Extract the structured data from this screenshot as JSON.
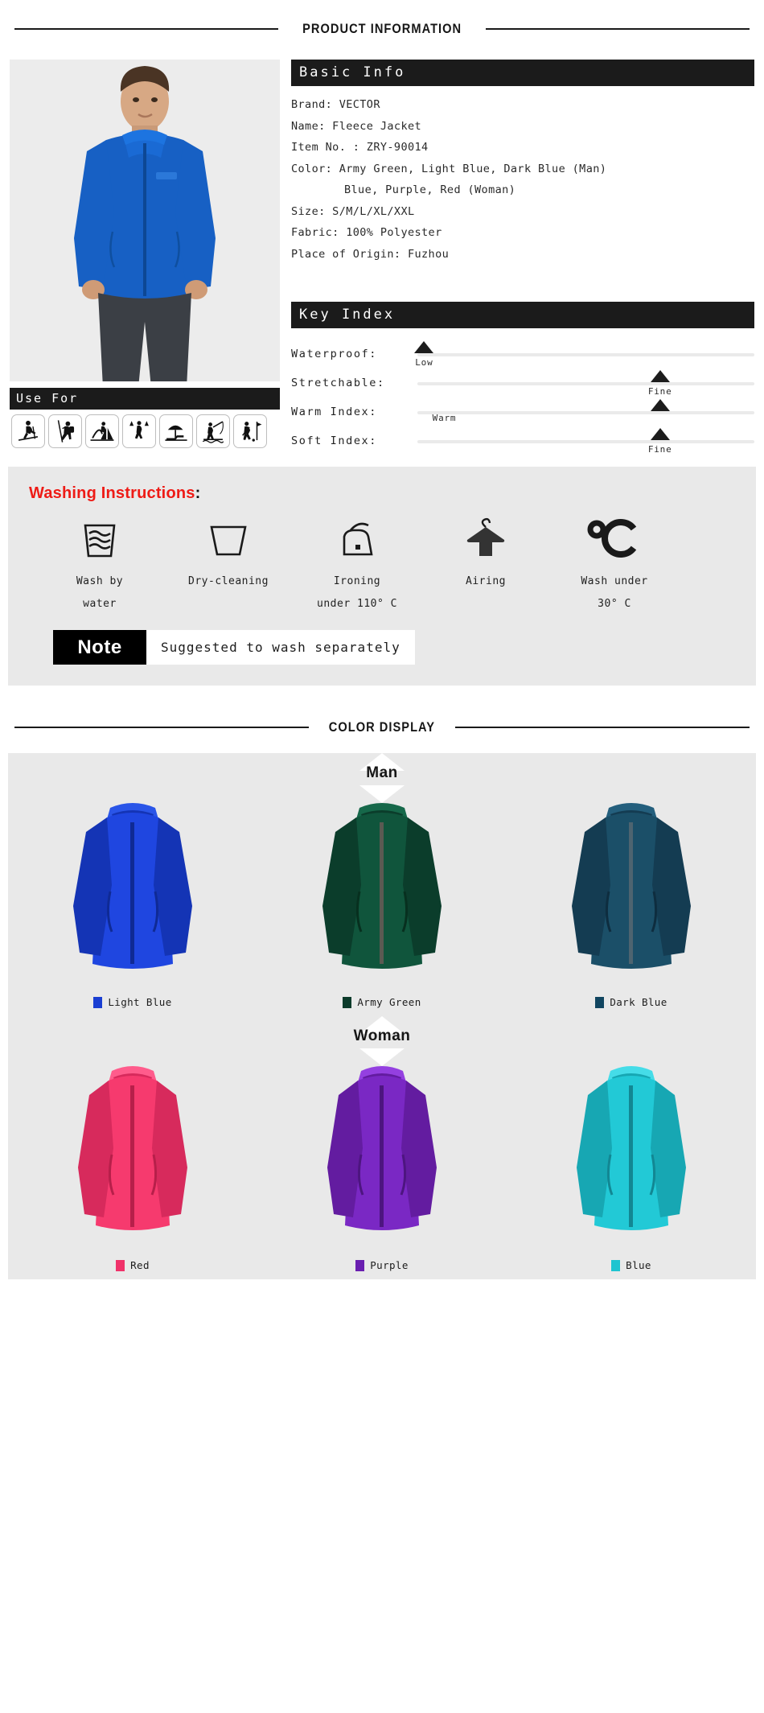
{
  "sections": {
    "product_information": "PRODUCT INFORMATION",
    "color_display": "COLOR DISPLAY"
  },
  "basic_info": {
    "heading": "Basic Info",
    "lines": [
      "Brand: VECTOR",
      "Name: Fleece Jacket",
      "Item No. : ZRY-90014",
      "Color: Army Green, Light Blue, Dark Blue (Man)",
      "Blue, Purple, Red (Woman)",
      "Size: S/M/L/XL/XXL",
      "Fabric: 100% Polyester",
      "Place of Origin: Fuzhou"
    ]
  },
  "key_index": {
    "heading": "Key Index",
    "rows": [
      {
        "label": "Waterproof:",
        "value": "Low",
        "percent": 2,
        "value_pos": "below"
      },
      {
        "label": "Stretchable:",
        "value": "Fine",
        "percent": 72,
        "value_pos": "below"
      },
      {
        "label": "Warm Index:",
        "value": "Warm",
        "percent": 72,
        "value_pos": "inline",
        "value_x": 8
      },
      {
        "label": "Soft Index:",
        "value": "Fine",
        "percent": 72,
        "value_pos": "below"
      }
    ]
  },
  "use_for": {
    "heading": "Use For",
    "activities": [
      "skiing",
      "climbing",
      "camping",
      "hiking",
      "beach-leisure",
      "fishing",
      "golf"
    ]
  },
  "washing": {
    "title": "Washing Instructions",
    "colon": ":",
    "items": [
      {
        "icon": "wash-by-water-icon",
        "caption": "Wash by\nwater"
      },
      {
        "icon": "dry-cleaning-icon",
        "caption": "Dry-cleaning"
      },
      {
        "icon": "ironing-icon",
        "caption": "Ironing\nunder 110° C"
      },
      {
        "icon": "airing-icon",
        "caption": "Airing"
      },
      {
        "icon": "temperature-icon",
        "caption": "Wash under\n30° C"
      }
    ],
    "note_tag": "Note",
    "note_text": "Suggested to wash separately"
  },
  "colors": {
    "man": {
      "title": "Man",
      "items": [
        {
          "label": "Light Blue",
          "chip": "#1a3ed2",
          "body": "#1f46e0",
          "shade": "#1434b5",
          "dark": "#0f2a95"
        },
        {
          "label": "Army Green",
          "chip": "#0c3b2b",
          "body": "#10553c",
          "shade": "#0b3d2b",
          "dark": "#07301f"
        },
        {
          "label": "Dark Blue",
          "chip": "#114560",
          "body": "#1b4f68",
          "shade": "#143c52",
          "dark": "#0e2d3f"
        }
      ]
    },
    "woman": {
      "title": "Woman",
      "items": [
        {
          "label": "Red",
          "chip": "#f0326a",
          "body": "#f63a6e",
          "shade": "#d72a5c",
          "dark": "#b71f4a"
        },
        {
          "label": "Purple",
          "chip": "#6a1fb0",
          "body": "#7a28c4",
          "shade": "#631ca0",
          "dark": "#4d1580"
        },
        {
          "label": "Blue",
          "chip": "#1ec4d0",
          "body": "#22c9d6",
          "shade": "#17a7b3",
          "dark": "#128793"
        }
      ]
    }
  }
}
